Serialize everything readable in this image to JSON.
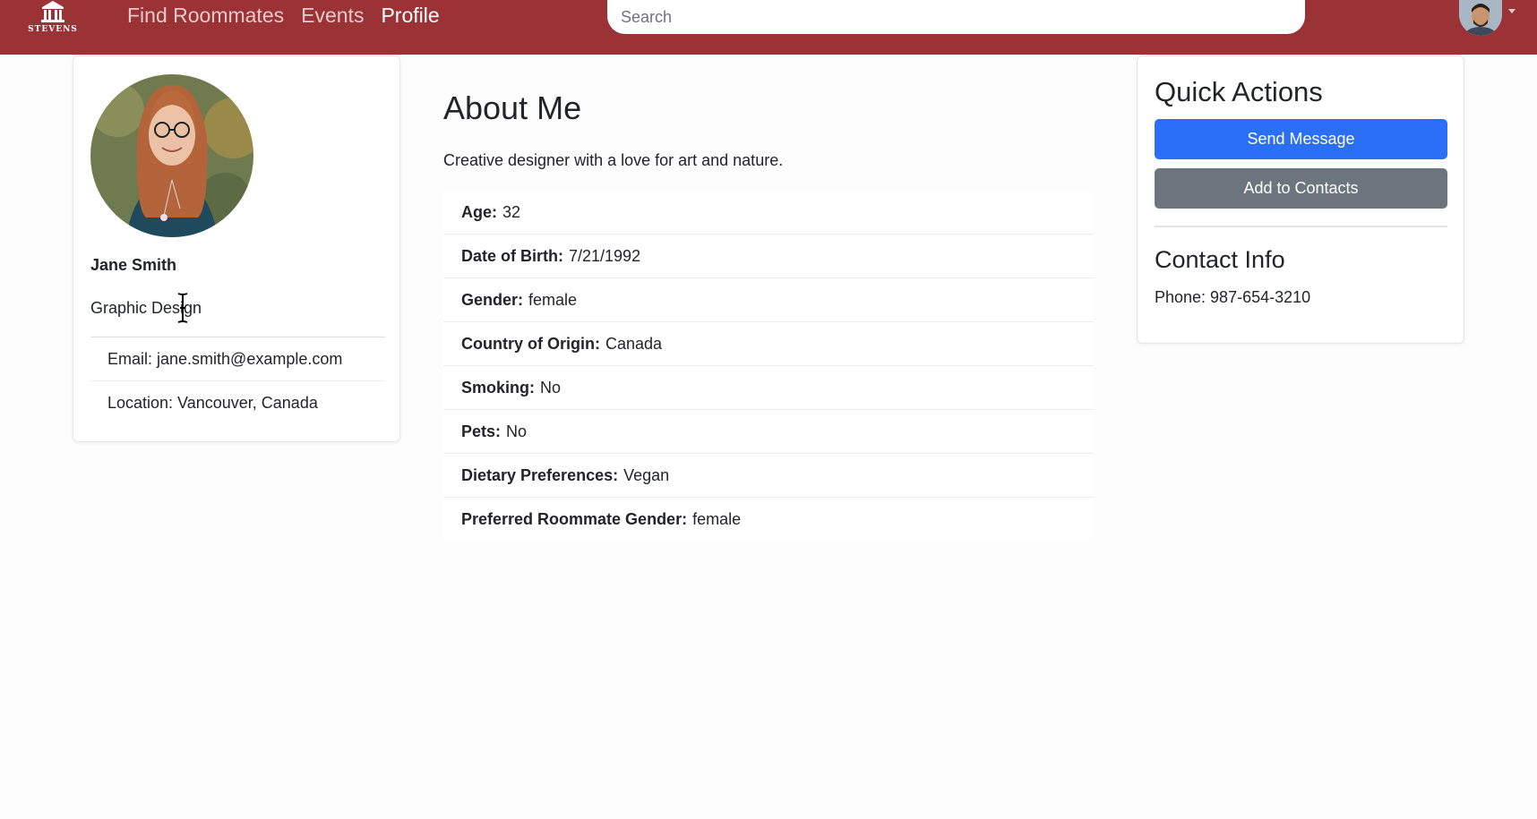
{
  "nav": {
    "brand_text": "STEVENS",
    "links": [
      "Find Roommates",
      "Events",
      "Profile"
    ],
    "active_link": "Profile",
    "search_placeholder": "Search"
  },
  "profile": {
    "name": "Jane Smith",
    "major": "Graphic Design",
    "details": [
      "Email: jane.smith@example.com",
      "Location: Vancouver, Canada"
    ]
  },
  "about": {
    "title": "About Me",
    "bio": "Creative designer with a love for art and nature.",
    "attributes": [
      {
        "label": "Age:",
        "value": "32"
      },
      {
        "label": "Date of Birth:",
        "value": "7/21/1992"
      },
      {
        "label": "Gender:",
        "value": "female"
      },
      {
        "label": "Country of Origin:",
        "value": "Canada"
      },
      {
        "label": "Smoking:",
        "value": "No"
      },
      {
        "label": "Pets:",
        "value": "No"
      },
      {
        "label": "Dietary Preferences:",
        "value": "Vegan"
      },
      {
        "label": "Preferred Roommate Gender:",
        "value": "female"
      }
    ]
  },
  "quick_actions": {
    "title": "Quick Actions",
    "send_message_label": "Send Message",
    "add_contacts_label": "Add to Contacts",
    "contact_title": "Contact Info",
    "phone": "Phone: 987-654-3210"
  },
  "colors": {
    "navbar": "#9b3236",
    "primary": "#2a6ff5",
    "secondary": "#6c757d"
  }
}
